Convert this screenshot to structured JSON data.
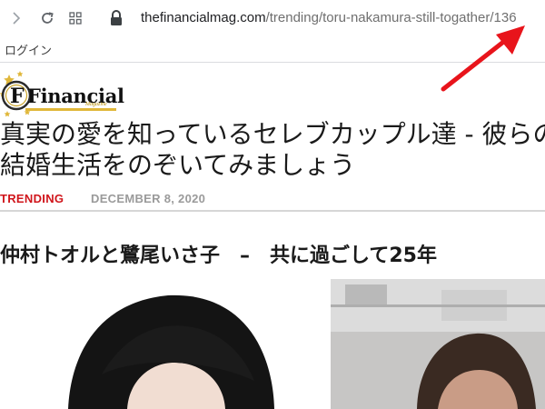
{
  "browser": {
    "url_host": "thefinancialmag.com",
    "url_path": "/trending/toru-nakamura-still-togather/136",
    "bookmark_item": "ログイン"
  },
  "site": {
    "logo_text": "Financial",
    "logo_subtext": "Magazine"
  },
  "article": {
    "headline": "真実の愛を知っているセレブカップル達 - 彼らの結婚生活をのぞいてみましょう",
    "category": "TRENDING",
    "date": "DECEMBER 8, 2020",
    "subheading": "仲村トオルと鷺尾いさ子　–　共に過ごして25年"
  },
  "colors": {
    "category_red": "#d0151b",
    "annotation_arrow": "#e8141b"
  }
}
